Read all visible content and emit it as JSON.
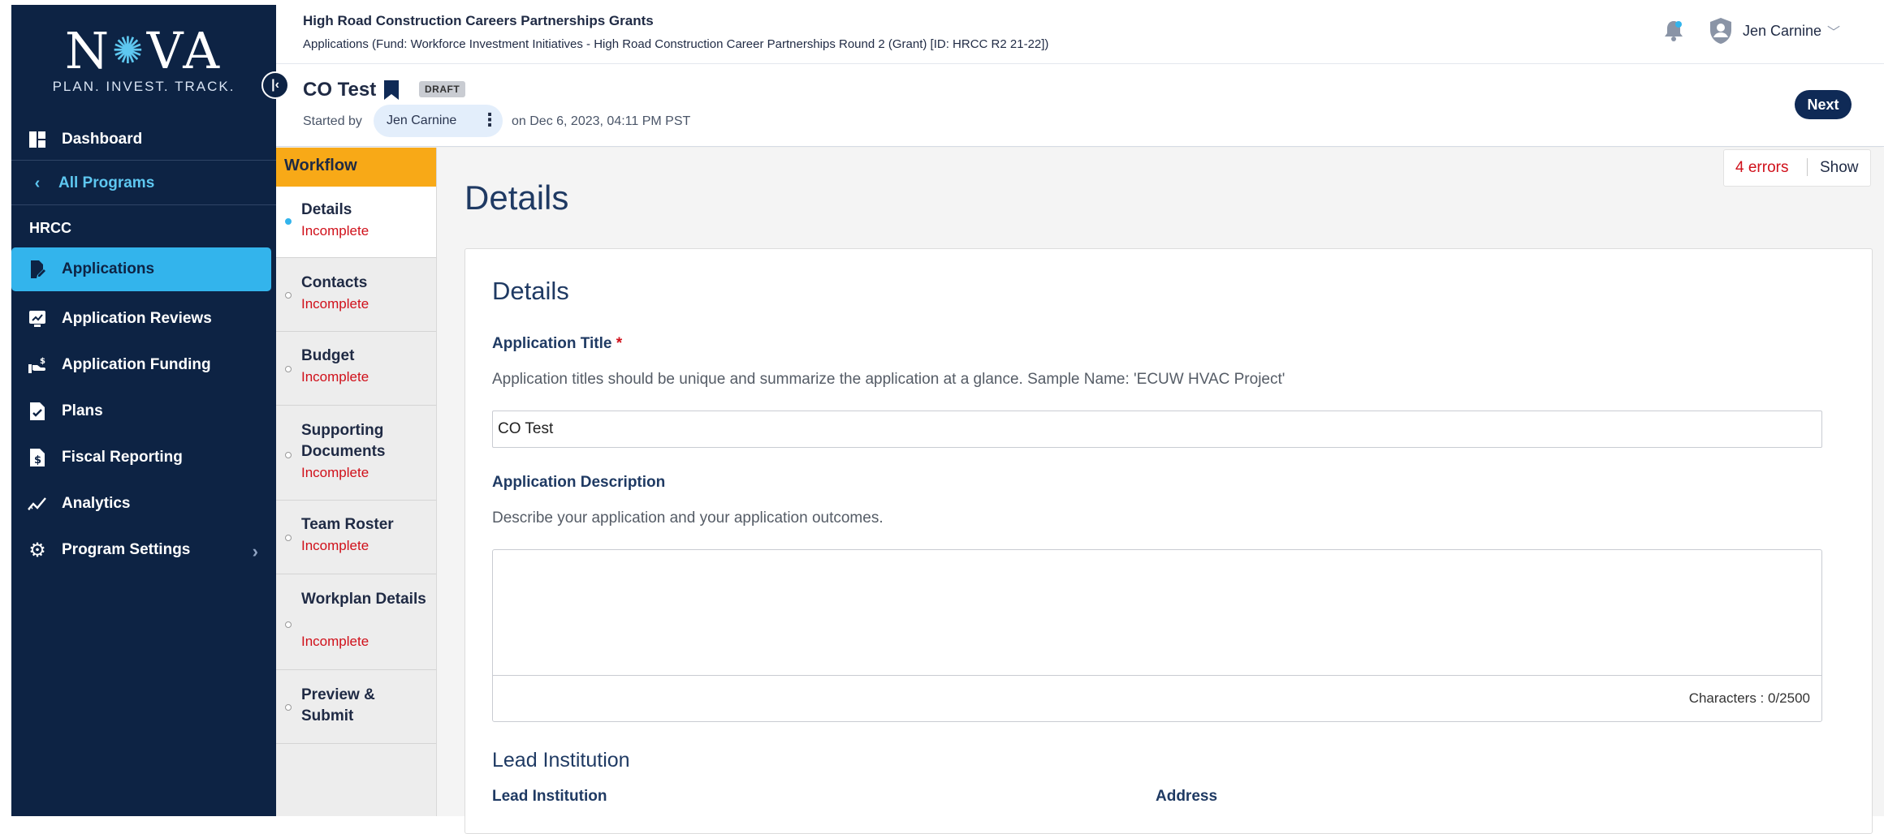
{
  "sidebar": {
    "logo": {
      "word_left": "N",
      "word_right": "VA",
      "tagline": "PLAN. INVEST. TRACK."
    },
    "dashboard": "Dashboard",
    "back": "All Programs",
    "program": "HRCC",
    "items": [
      {
        "label": "Applications",
        "icon": "edit-document-icon",
        "active": true
      },
      {
        "label": "Application Reviews",
        "icon": "review-icon"
      },
      {
        "label": "Application Funding",
        "icon": "funding-hand-icon"
      },
      {
        "label": "Plans",
        "icon": "checked-document-icon"
      },
      {
        "label": "Fiscal Reporting",
        "icon": "dollar-document-icon"
      },
      {
        "label": "Analytics",
        "icon": "trend-line-icon"
      },
      {
        "label": "Program Settings",
        "icon": "gear-icon"
      }
    ]
  },
  "header": {
    "program_title": "High Road Construction Careers Partnerships Grants",
    "program_sub": "Applications (Fund: Workforce Investment Initiatives - High Road Construction Career Partnerships Round 2 (Grant) [ID: HRCC R2 21-22])",
    "user": "Jen Carnine",
    "app_name": "CO Test",
    "badge": "DRAFT",
    "started_by_label": "Started by",
    "started_by": "Jen Carnine",
    "started_on": "on Dec 6, 2023, 04:11 PM PST",
    "next_label": "Next"
  },
  "workflow": {
    "title": "Workflow",
    "steps": [
      {
        "label": "Details",
        "status": "Incomplete"
      },
      {
        "label": "Contacts",
        "status": "Incomplete"
      },
      {
        "label": "Budget",
        "status": "Incomplete"
      },
      {
        "label": "Supporting Documents",
        "status": "Incomplete"
      },
      {
        "label": "Team Roster",
        "status": "Incomplete"
      },
      {
        "label": "Workplan Details",
        "status": "Incomplete"
      },
      {
        "label": "Preview & Submit",
        "status": ""
      }
    ]
  },
  "errors": {
    "count": "4 errors",
    "show": "Show"
  },
  "main": {
    "page_title": "Details",
    "card_title": "Details",
    "app_title_label": "Application Title",
    "app_title_required": "*",
    "app_title_help": "Application titles should be unique and summarize the application at a glance. Sample Name: 'ECUW HVAC Project'",
    "app_title_value": "CO Test",
    "app_desc_label": "Application Description",
    "app_desc_help": "Describe your application and your application outcomes.",
    "app_desc_value": "",
    "char_count": "Characters : 0/2500",
    "lead_section": "Lead Institution",
    "lead_label": "Lead Institution",
    "address_label": "Address"
  },
  "colors": {
    "sidebar_bg": "#0d2344",
    "active_nav": "#33b4ec",
    "workflow_header": "#f8a917",
    "error_red": "#d0101a",
    "next_button": "#0f2a56"
  }
}
